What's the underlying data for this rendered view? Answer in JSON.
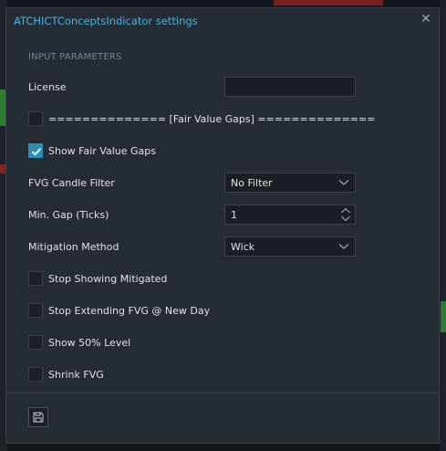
{
  "dialog": {
    "title": "ATCHICTConceptsIndicator settings",
    "close_icon": "close-icon"
  },
  "section": {
    "title": "INPUT PARAMETERS"
  },
  "params": {
    "license_label": "License",
    "license_value": "",
    "fvg_header_label": "============== [Fair Value Gaps] ==============",
    "fvg_header_checked": false,
    "show_fvg_label": "Show Fair Value Gaps",
    "show_fvg_checked": true,
    "candle_filter_label": "FVG Candle Filter",
    "candle_filter_value": "No Filter",
    "min_gap_label": "Min. Gap (Ticks)",
    "min_gap_value": "1",
    "mitigation_label": "Mitigation Method",
    "mitigation_value": "Wick",
    "stop_mitigated_label": "Stop Showing Mitigated",
    "stop_mitigated_checked": false,
    "stop_extending_label": "Stop Extending FVG @ New Day",
    "stop_extending_checked": false,
    "show_50_label": "Show 50% Level",
    "show_50_checked": false,
    "shrink_label": "Shrink FVG",
    "shrink_checked": false
  },
  "footer": {
    "save_icon": "save-icon"
  },
  "colors": {
    "accent": "#3fb5e6",
    "checked": "#2c8fb5",
    "panel": "#262c33"
  }
}
